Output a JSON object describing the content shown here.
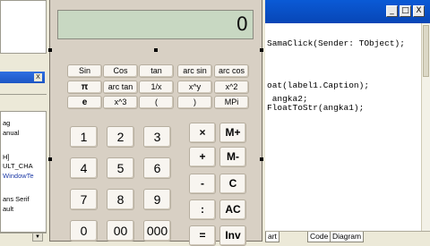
{
  "ide": {
    "code_lines": [
      "SamaClick(Sender: TObject);",
      "",
      "oat(label1.Caption);",
      " angka2;",
      "FloatToStr(angka1);"
    ],
    "editor_tabs": [
      "art",
      "Code",
      "Diagram"
    ],
    "window_buttons": [
      "_",
      "□",
      "X"
    ],
    "panel_close": "X",
    "inspector_rows": [
      "ag",
      "anual",
      "",
      "H]",
      "ULT_CHA",
      "WindowTe",
      "",
      "ans Serif",
      "ault",
      ""
    ],
    "inspector_dropdown": "▼"
  },
  "calculator": {
    "display_value": "0",
    "function_rows": [
      [
        "Sin",
        "Cos",
        "tan",
        "arc sin",
        "arc cos"
      ],
      [
        "π",
        "arc tan",
        "1/x",
        "x^y",
        "x^2"
      ],
      [
        "e",
        "x^3",
        "(",
        ")",
        "MPi"
      ]
    ],
    "number_rows": [
      [
        "1",
        "2",
        "3"
      ],
      [
        "4",
        "5",
        "6"
      ],
      [
        "7",
        "8",
        "9"
      ],
      [
        "0",
        "00",
        "000"
      ]
    ],
    "operator_rows": [
      [
        "×",
        "M+"
      ],
      [
        "+",
        "M-"
      ],
      [
        "-",
        "C"
      ],
      [
        ":",
        "AC"
      ],
      [
        "=",
        "Inv"
      ]
    ]
  }
}
